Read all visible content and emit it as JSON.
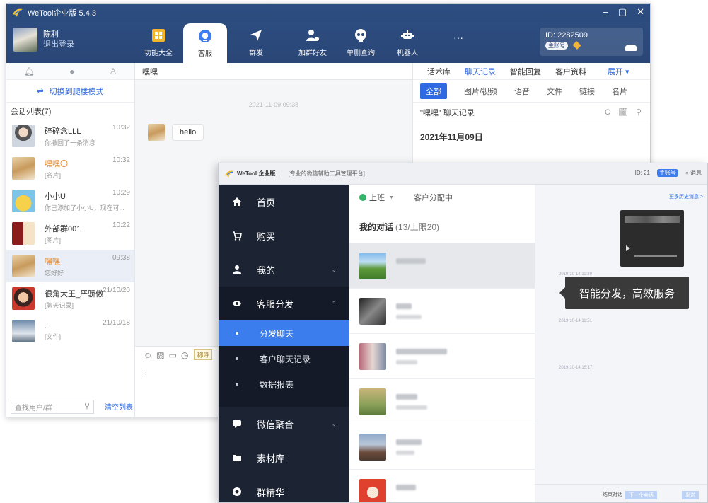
{
  "back_window": {
    "title": "WeTool企业版 5.4.3",
    "window_buttons": [
      "–",
      "▢",
      "✕"
    ],
    "user": {
      "name": "陈利",
      "logout": "退出登录"
    },
    "nav": [
      {
        "label": "功能大全",
        "icon": "grid-icon"
      },
      {
        "label": "客服",
        "icon": "headset-icon"
      },
      {
        "label": "群发",
        "icon": "send-icon"
      },
      {
        "label": "加群好友",
        "icon": "add-friend-icon"
      },
      {
        "label": "单删查询",
        "icon": "skull-icon"
      },
      {
        "label": "机器人",
        "icon": "robot-icon"
      },
      {
        "label": "···",
        "icon": "more-icon"
      }
    ],
    "account": {
      "id": "ID: 2282509",
      "tag": "主账号"
    },
    "left": {
      "switch_icon": "⇌",
      "switch_label": "切换到爬楼模式",
      "list_title": "会话列表(7)",
      "search_placeholder": "查找用户/群",
      "clear_label": "清空列表",
      "conversations": [
        {
          "name": "碎碎念LLL",
          "preview": "你撤回了一条消息",
          "time": "10:32"
        },
        {
          "name": "嘿嘿〇",
          "preview": "[名片]",
          "time": "10:32"
        },
        {
          "name": "小小U",
          "preview": "你已添加了小小U，现在可...",
          "time": "10:29"
        },
        {
          "name": "外部群001",
          "preview": "[图片]",
          "time": "10:22"
        },
        {
          "name": "嘿嘿",
          "preview": "您好好",
          "time": "09:38"
        },
        {
          "name": "很角大王_严骄傲",
          "preview": "[聊天记录]",
          "time": "21/10/20"
        },
        {
          "name": ". .",
          "preview": "[文件]",
          "time": "21/10/18"
        }
      ]
    },
    "chat": {
      "header": "嘿嘿",
      "timestamp": "2021-11-09 09:38",
      "message": "hello",
      "nick_chip": "称呼"
    },
    "right": {
      "tabs": [
        "话术库",
        "聊天记录",
        "智能回复",
        "客户资料"
      ],
      "expand": "展开 ▾",
      "filters": [
        "全部",
        "图片/视频",
        "语音",
        "文件",
        "链接",
        "名片"
      ],
      "record_title": "\"嘿嘿\" 聊天记录",
      "record_tools": "C 🗓 ⚲",
      "date": "2021年11月09日"
    }
  },
  "front_window": {
    "app_name": "WeTool 企业版",
    "slogan": "[专业的微信辅助工具管理平台]",
    "top_right": {
      "id": "ID: 21",
      "chip": "主账号",
      "msg": "○ 消息"
    },
    "sidebar": {
      "items": [
        {
          "label": "首页",
          "icon": "home-icon"
        },
        {
          "label": "购买",
          "icon": "cart-icon"
        },
        {
          "label": "我的",
          "icon": "user-icon"
        }
      ],
      "group": {
        "label": "客服分发",
        "icon": "eye-icon"
      },
      "sub_items": [
        "分发聊天",
        "客户聊天记录",
        "数据报表"
      ],
      "bottom_items": [
        {
          "label": "微信聚合",
          "icon": "chat-bubble-icon"
        },
        {
          "label": "素材库",
          "icon": "folder-icon"
        },
        {
          "label": "群精华",
          "icon": "badge-icon"
        }
      ]
    },
    "list": {
      "status": "上班",
      "assign": "客户分配中",
      "my_conv": "我的对话",
      "count": "(13/上限20)"
    },
    "chat": {
      "more_history": "更多历史消息 >",
      "timestamps": [
        "2019-10-14 11:39",
        "2019-10-14 11:51",
        "2019-10-14 15:17"
      ],
      "end_chat": "结束对话",
      "next": "下一个会话",
      "send": "发送"
    },
    "tooltip": "智能分发，高效服务"
  },
  "colors": {
    "nav_blue": "#2b4a7c",
    "accent": "#2f6ae3",
    "sidebar_dark": "#1c2434",
    "sidebar_active": "#3b7ded"
  }
}
